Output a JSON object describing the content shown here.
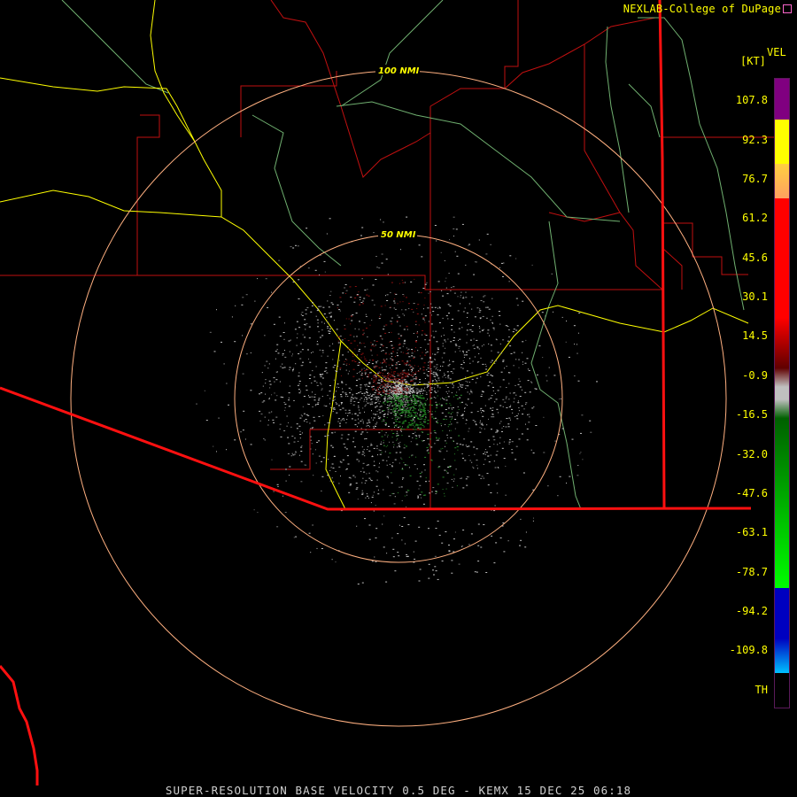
{
  "header": {
    "credit": "NEXLAB-College of DuPage"
  },
  "legend": {
    "title": "VEL",
    "unit": "[KT]",
    "ticks": [
      "107.8",
      "92.3",
      "76.7",
      "61.2",
      "45.6",
      "30.1",
      "14.5",
      "-0.9",
      "-16.5",
      "-32.0",
      "-47.6",
      "-63.1",
      "-78.7",
      "-94.2",
      "-109.8",
      "TH"
    ],
    "colors": {
      "purple": "#800080",
      "yellow": "#ffff00",
      "orange": "#ffa060",
      "red": "#ff0000",
      "dark_red": "#600000",
      "gray": "#c0c0c0",
      "dark_green": "#006000",
      "green": "#00ff00",
      "blue": "#0000c0",
      "light_blue": "#00c0ff",
      "black": "#000000"
    }
  },
  "map": {
    "range_rings": [
      {
        "label": "50 NMI"
      },
      {
        "label": "100 NMI"
      }
    ],
    "colors": {
      "ring": "#ffb080",
      "county": "#c01010",
      "state_border": "#ff1010",
      "highway": "#ffff00",
      "river": "#70c070",
      "echo_gray": "#bfbfbf",
      "echo_red": "#8a1010",
      "echo_green": "#2a8a2a"
    }
  },
  "caption": "SUPER-RESOLUTION BASE VELOCITY 0.5 DEG - KEMX 15 DEC 25 06:18"
}
